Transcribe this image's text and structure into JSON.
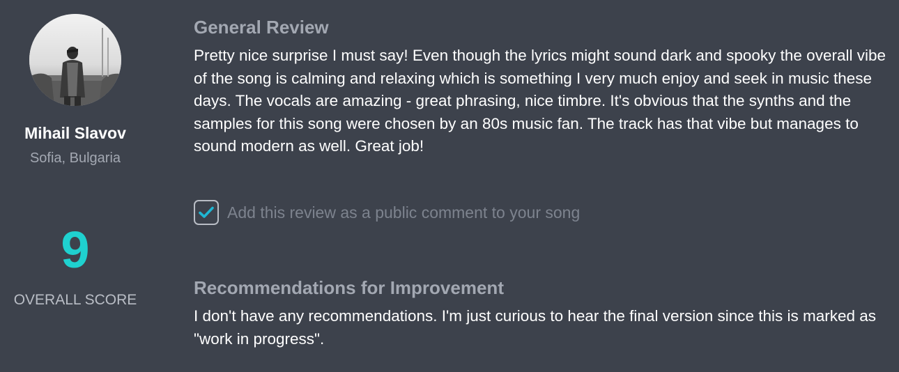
{
  "reviewer": {
    "name": "Mihail Slavov",
    "location": "Sofia, Bulgaria",
    "avatar_icon": "person-photo-avatar"
  },
  "score": {
    "value": "9",
    "label": "OVERALL SCORE",
    "color": "#1fd1cf"
  },
  "general_review": {
    "heading": "General Review",
    "text": "Pretty nice surprise I must say! Even though the lyrics might sound dark and spooky the overall vibe of the song is calming and relaxing which is something I very much enjoy and seek in music these days. The vocals are amazing - great phrasing, nice timbre. It's obvious that the synths and the samples for this song were chosen by an 80s music fan. The track has that vibe but manages to sound modern as well. Great job!"
  },
  "public_comment": {
    "checked": true,
    "label": "Add this review as a public comment to your song",
    "check_icon": "checkmark-icon"
  },
  "recommendations": {
    "heading": "Recommendations for Improvement",
    "text": "I don't have any recommendations. I'm just curious to hear the final version since this is marked as \"work in progress\"."
  },
  "colors": {
    "background": "#3d424c",
    "accent": "#1fd1cf",
    "muted_text": "#a3a8b2",
    "primary_text": "#ffffff"
  }
}
